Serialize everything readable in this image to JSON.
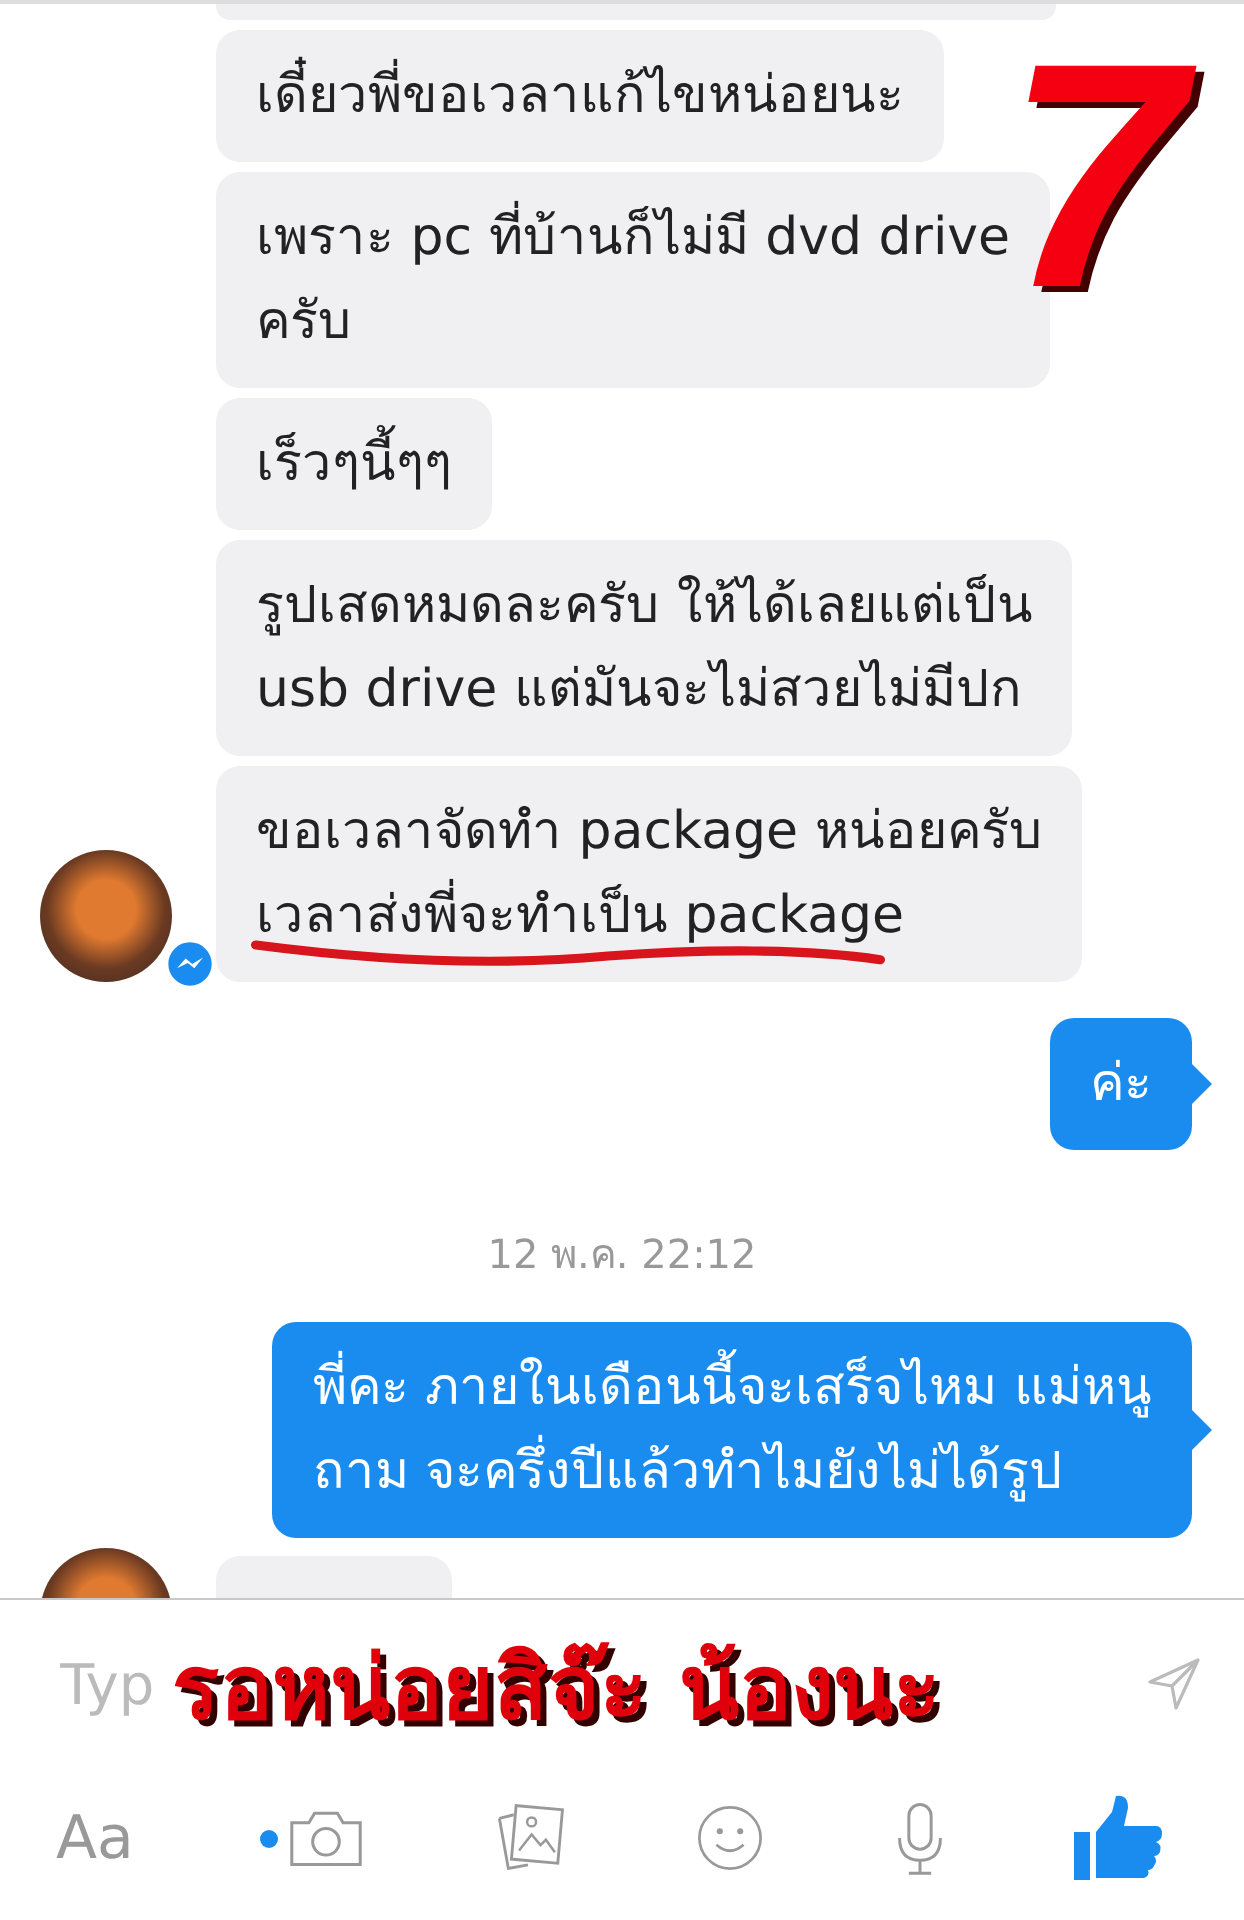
{
  "messages": [
    {
      "kind": "clipped"
    },
    {
      "kind": "received",
      "avatar": false,
      "lines": [
        "เดี๋ยวพี่ขอเวลาแก้ไขหน่อยนะ"
      ]
    },
    {
      "kind": "received",
      "avatar": false,
      "lines": [
        "เพราะ pc ที่บ้านก็ไม่มี dvd drive",
        "ครับ"
      ]
    },
    {
      "kind": "received",
      "avatar": false,
      "lines": [
        "เร็วๆนี้ๆๆ"
      ]
    },
    {
      "kind": "received",
      "avatar": false,
      "lines": [
        "รูปเสดหมดละครับ  ให้ได้เลยแต่เป็น",
        "usb drive แต่มันจะไม่สวยไม่มีปก"
      ]
    },
    {
      "kind": "received",
      "avatar": true,
      "underlined": true,
      "lines": [
        "ขอเวลาจัดทำ package หน่อยครับ",
        "เวลาส่งพี่จะทำเป็น package"
      ]
    },
    {
      "kind": "sent",
      "lines": [
        "ค่ะ"
      ]
    },
    {
      "kind": "time",
      "lines": [
        "12 พ.ค. 22:12"
      ]
    },
    {
      "kind": "sent",
      "lines": [
        "พี่คะ ภายในเดือนนี้จะเสร็จไหม แม่หนู",
        "ถาม จะครึ่งปีแล้วทำไมยังไม่ได้รูป"
      ]
    },
    {
      "kind": "clipped",
      "avatar": true
    }
  ],
  "composer": {
    "placeholder": "Typ",
    "font_button": "Aa",
    "camera_new": true
  },
  "overlay": {
    "number": "7",
    "caption": "รอหน่อยสิจ๊ะ น้องนะ"
  }
}
